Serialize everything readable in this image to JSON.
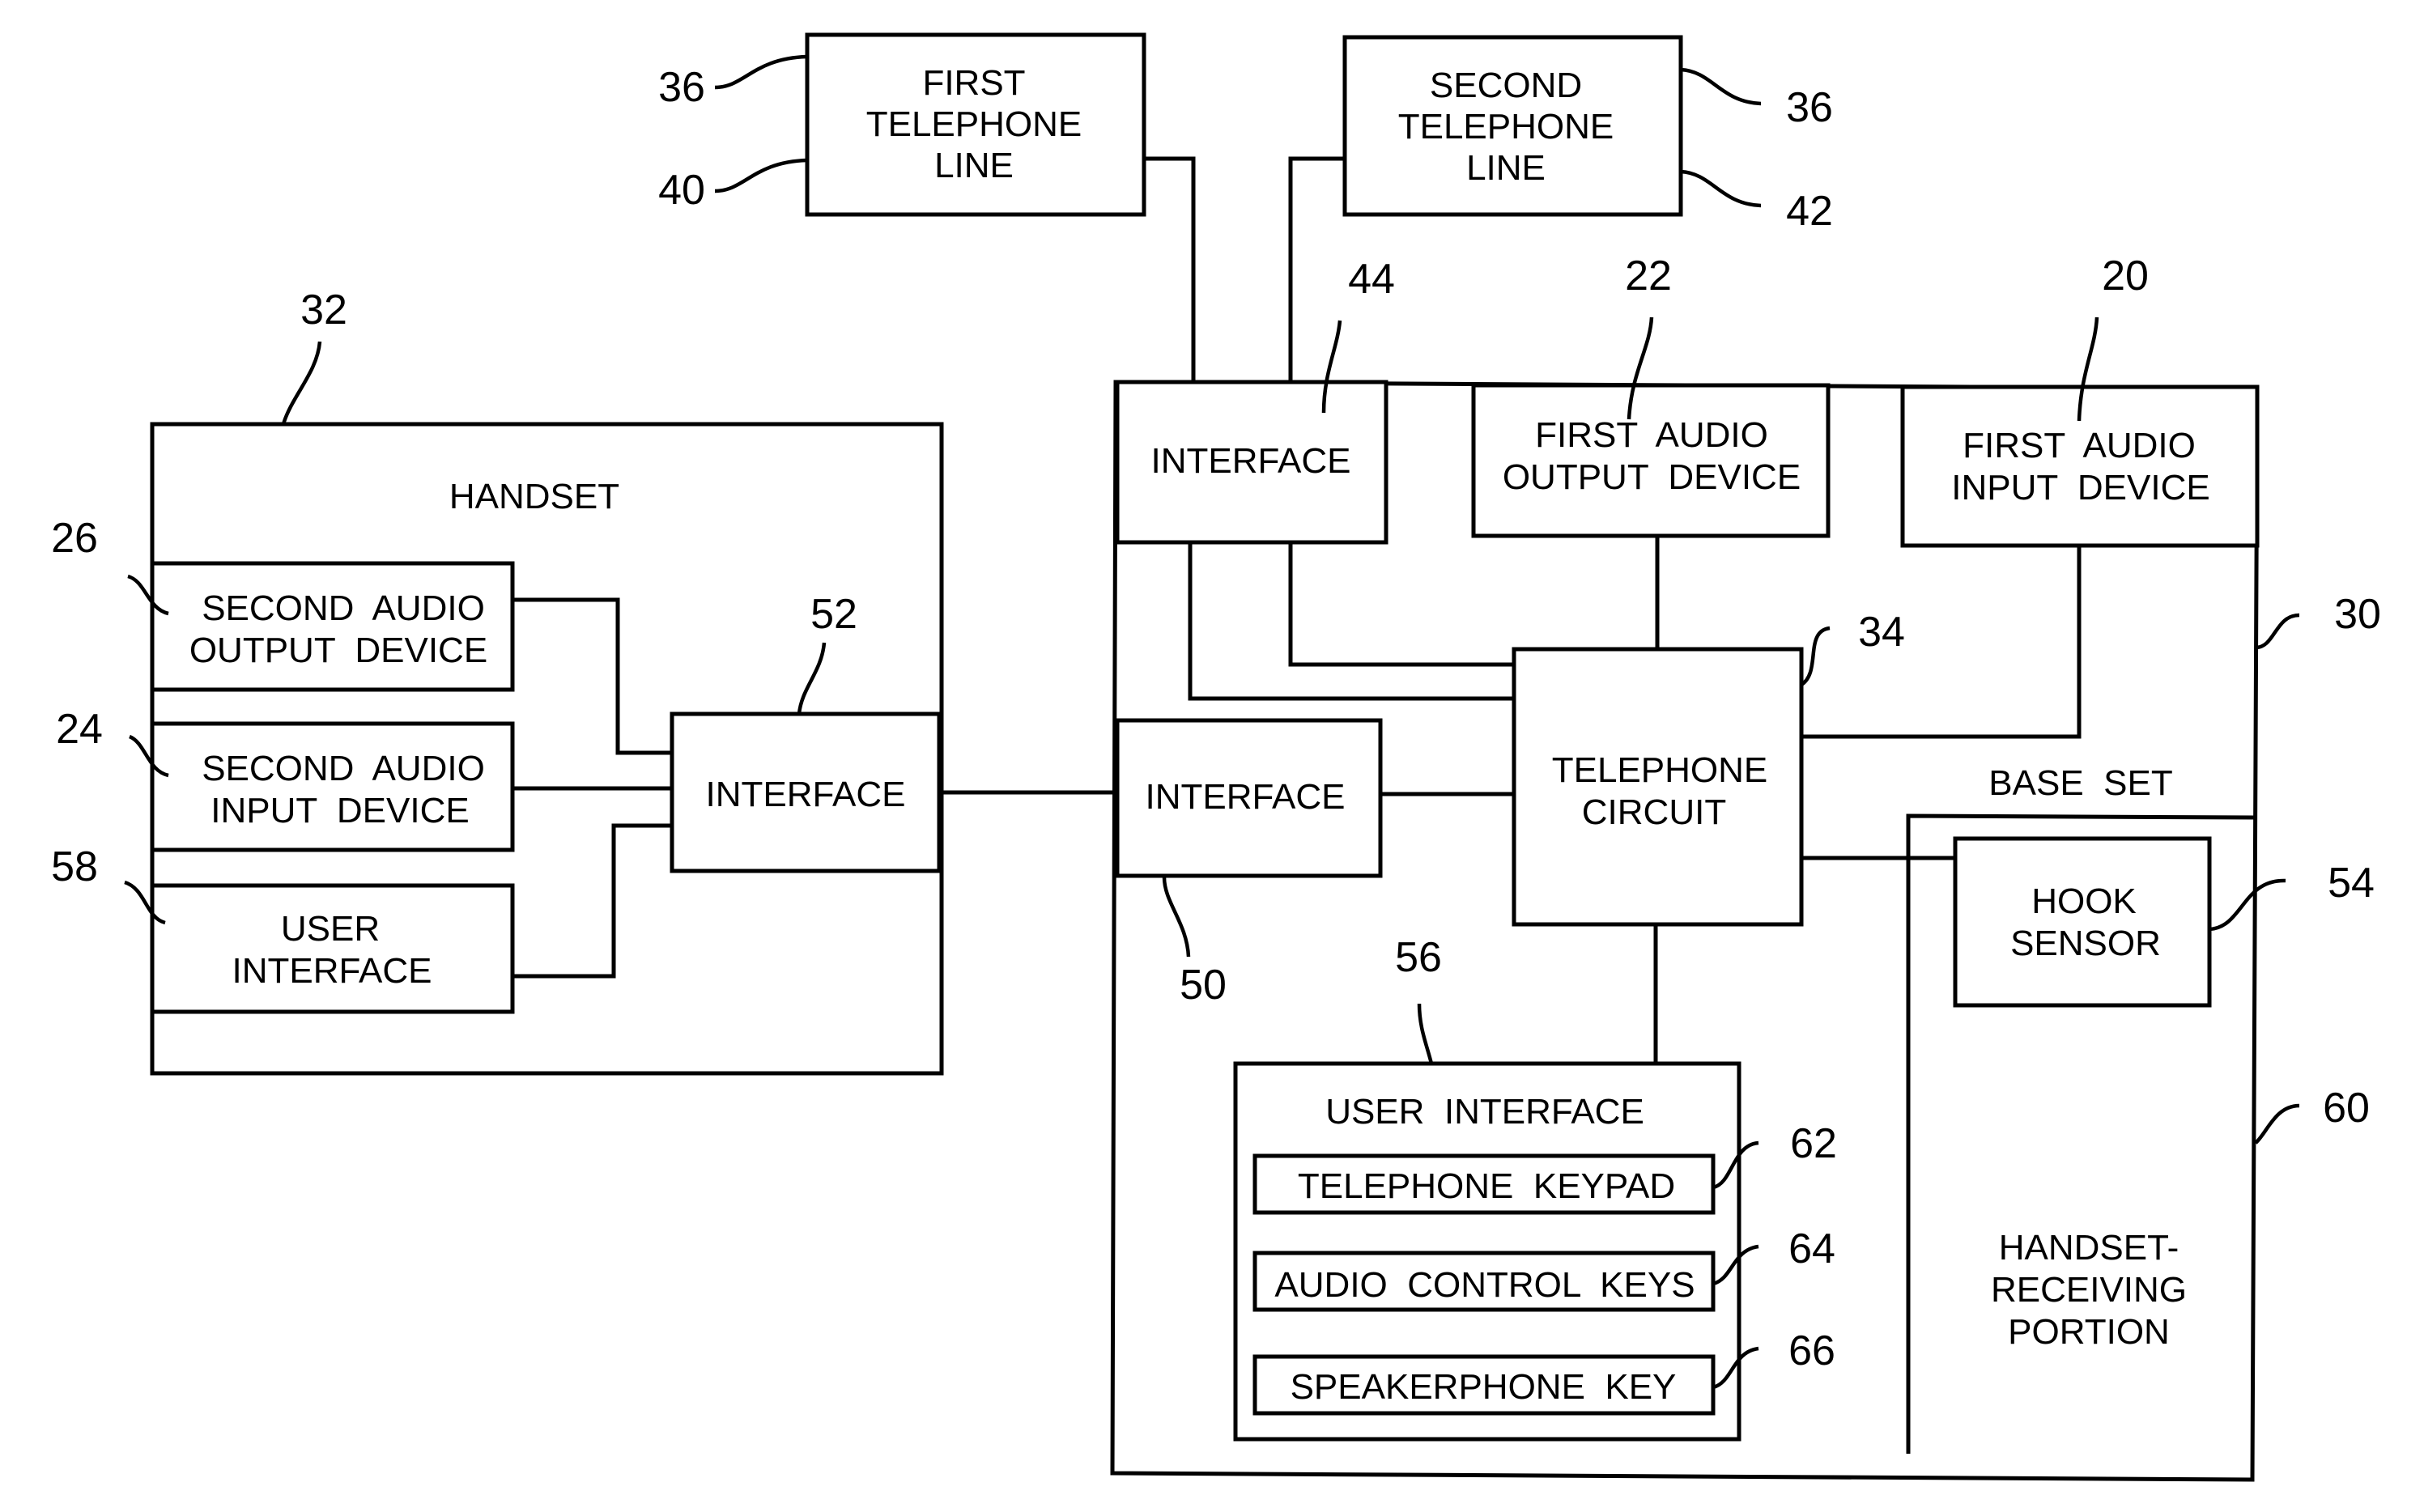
{
  "figure": {
    "blocks": {
      "first_line": [
        "FIRST",
        "TELEPHONE",
        "LINE"
      ],
      "second_line": [
        "SECOND",
        "TELEPHONE",
        "LINE"
      ],
      "handset": [
        "HANDSET"
      ],
      "second_audio_output": [
        "SECOND  AUDIO",
        "OUTPUT  DEVICE"
      ],
      "second_audio_input": [
        "SECOND  AUDIO",
        "INPUT  DEVICE"
      ],
      "handset_user_interface": [
        "USER",
        "INTERFACE"
      ],
      "handset_interface": [
        "INTERFACE"
      ],
      "base_line_interface": [
        "INTERFACE"
      ],
      "first_audio_output": [
        "FIRST  AUDIO",
        "OUTPUT  DEVICE"
      ],
      "first_audio_input": [
        "FIRST  AUDIO",
        "INPUT  DEVICE"
      ],
      "base_handset_interface": [
        "INTERFACE"
      ],
      "telephone_circuit": [
        "TELEPHONE",
        "CIRCUIT"
      ],
      "base_set": [
        "BASE  SET"
      ],
      "hook_sensor": [
        "HOOK",
        "SENSOR"
      ],
      "base_user_interface": [
        "USER  INTERFACE"
      ],
      "telephone_keypad": [
        "TELEPHONE  KEYPAD"
      ],
      "audio_control_keys": [
        "AUDIO  CONTROL  KEYS"
      ],
      "speakerphone_key": [
        "SPEAKERPHONE  KEY"
      ],
      "handset_receiving": [
        "HANDSET-",
        "RECEIVING",
        "PORTION"
      ]
    },
    "refs": {
      "first_line_a": "36",
      "first_line_b": "40",
      "second_line_a": "36",
      "second_line_b": "42",
      "handset": "32",
      "second_audio_output": "26",
      "second_audio_input": "24",
      "handset_user_interface": "58",
      "handset_interface": "52",
      "base_line_interface": "44",
      "first_audio_output": "22",
      "first_audio_input": "20",
      "telephone_circuit": "34",
      "base_set": "30",
      "base_handset_interface": "50",
      "hook_sensor": "54",
      "base_user_interface": "56",
      "handset_receiving": "60",
      "telephone_keypad": "62",
      "audio_control_keys": "64",
      "speakerphone_key": "66"
    }
  }
}
